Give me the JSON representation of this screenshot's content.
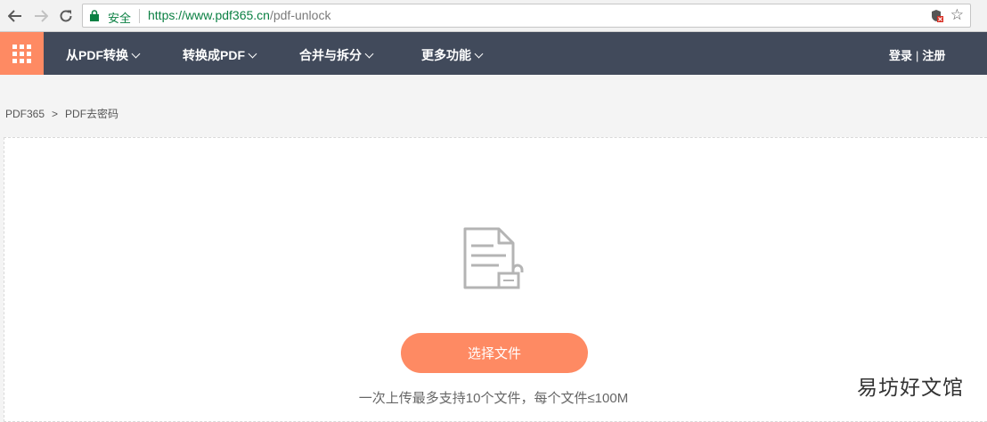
{
  "browser": {
    "secure_label": "安全",
    "url_host": "https://www.pdf365.cn",
    "url_path": "/pdf-unlock"
  },
  "header": {
    "menus": [
      {
        "label": "从PDF转换"
      },
      {
        "label": "转换成PDF"
      },
      {
        "label": "合并与拆分"
      },
      {
        "label": "更多功能"
      }
    ],
    "login": "登录",
    "separator": "|",
    "register": "注册"
  },
  "breadcrumb": {
    "home": "PDF365",
    "separator": ">",
    "current": "PDF去密码"
  },
  "upload": {
    "button_label": "选择文件",
    "hint": "一次上传最多支持10个文件，每个文件≤100M"
  },
  "watermark": "易坊好文馆",
  "colors": {
    "accent": "#fe8a63",
    "header_bg": "#414a5b",
    "secure_green": "#0b8043"
  }
}
